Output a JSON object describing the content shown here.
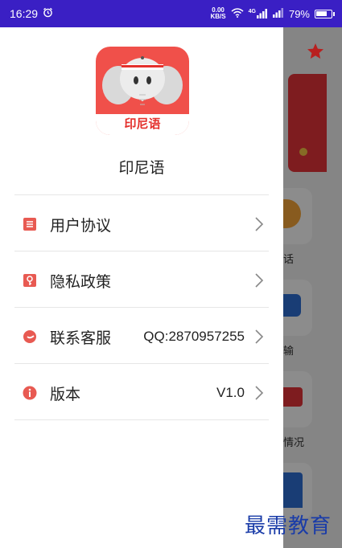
{
  "status_bar": {
    "time": "16:29",
    "alarm_icon": "alarm-icon",
    "net_speed_value": "0.00",
    "net_speed_unit": "KB/S",
    "network_label": "4G",
    "battery_percent": "79%",
    "battery_level": 0.79
  },
  "drawer": {
    "logo_text": "印尼语",
    "app_name": "印尼语",
    "items": [
      {
        "label": "用户协议",
        "value": "",
        "icon": "document-icon",
        "icon_color": "#e85a52"
      },
      {
        "label": "隐私政策",
        "value": "",
        "icon": "privacy-icon",
        "icon_color": "#e85a52"
      },
      {
        "label": "联系客服",
        "value": "QQ:2870957255",
        "icon": "contact-icon",
        "icon_color": "#e85a52"
      },
      {
        "label": "版本",
        "value": "V1.0",
        "icon": "info-icon",
        "icon_color": "#e85a52"
      }
    ]
  },
  "background": {
    "labels": [
      "话",
      "输",
      "情况"
    ],
    "accent": "#e5343a"
  },
  "watermark": "最需教育",
  "colors": {
    "status_bar": "#3a1fc4",
    "accent": "#e85a52"
  }
}
